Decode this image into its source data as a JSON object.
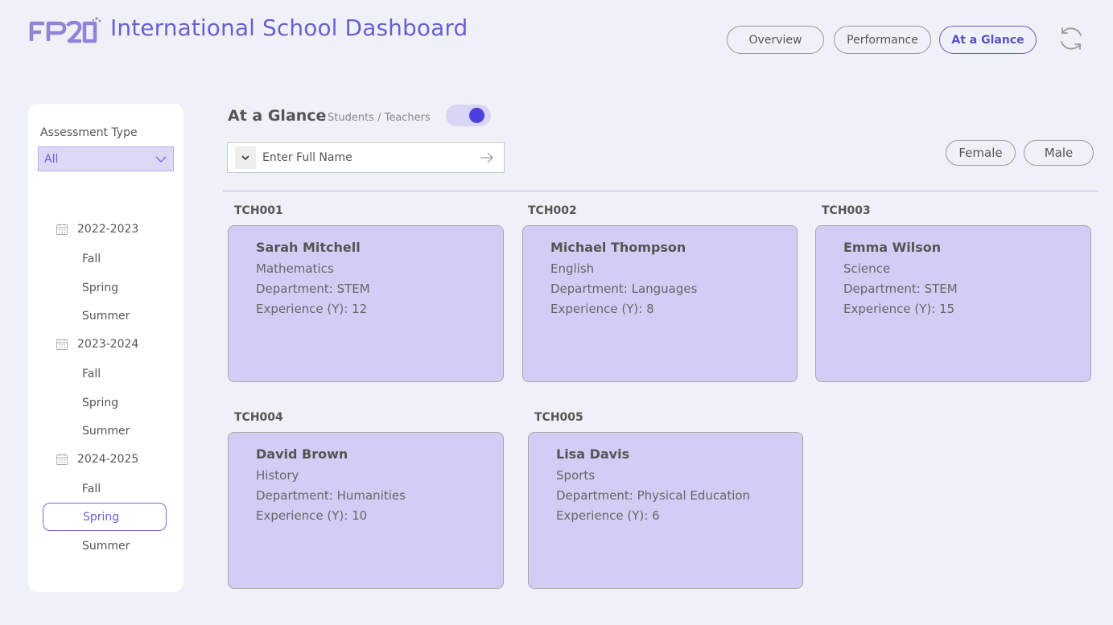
{
  "header": {
    "logo_text": "FP20",
    "title": "International School Dashboard",
    "nav": [
      {
        "label": "Overview",
        "active": false
      },
      {
        "label": "Performance",
        "active": false
      },
      {
        "label": "At a Glance",
        "active": true
      }
    ],
    "refresh_icon": "refresh-icon",
    "accent_color": "#6b5fd0"
  },
  "sidebar": {
    "assessment_label": "Assessment Type",
    "assessment_value": "All",
    "years": [
      {
        "label": "2022-2023",
        "terms": [
          "Fall",
          "Spring",
          "Summer"
        ]
      },
      {
        "label": "2023-2024",
        "terms": [
          "Fall",
          "Spring",
          "Summer"
        ]
      },
      {
        "label": "2024-2025",
        "terms": [
          "Fall",
          "Spring",
          "Summer"
        ]
      }
    ],
    "selected_term": "2024-2025 Spring"
  },
  "main": {
    "title": "At a Glance",
    "subtitle": "Students / Teachers",
    "toggle_on": true,
    "search_placeholder": "Enter Full Name",
    "gender_filters": [
      "Female",
      "Male"
    ],
    "teachers": [
      {
        "id": "TCH001",
        "name": "Sarah Mitchell",
        "subject": "Mathematics",
        "department": "Department: STEM",
        "experience": "Experience (Y): 12"
      },
      {
        "id": "TCH002",
        "name": "Michael Thompson",
        "subject": "English",
        "department": "Department: Languages",
        "experience": "Experience (Y): 8"
      },
      {
        "id": "TCH003",
        "name": "Emma Wilson",
        "subject": "Science",
        "department": "Department: STEM",
        "experience": "Experience (Y): 15"
      },
      {
        "id": "TCH004",
        "name": "David Brown",
        "subject": "History",
        "department": "Department: Humanities",
        "experience": "Experience (Y): 10"
      },
      {
        "id": "TCH005",
        "name": "Lisa Davis",
        "subject": "Sports",
        "department": "Department: Physical Education",
        "experience": "Experience (Y): 6"
      }
    ]
  }
}
